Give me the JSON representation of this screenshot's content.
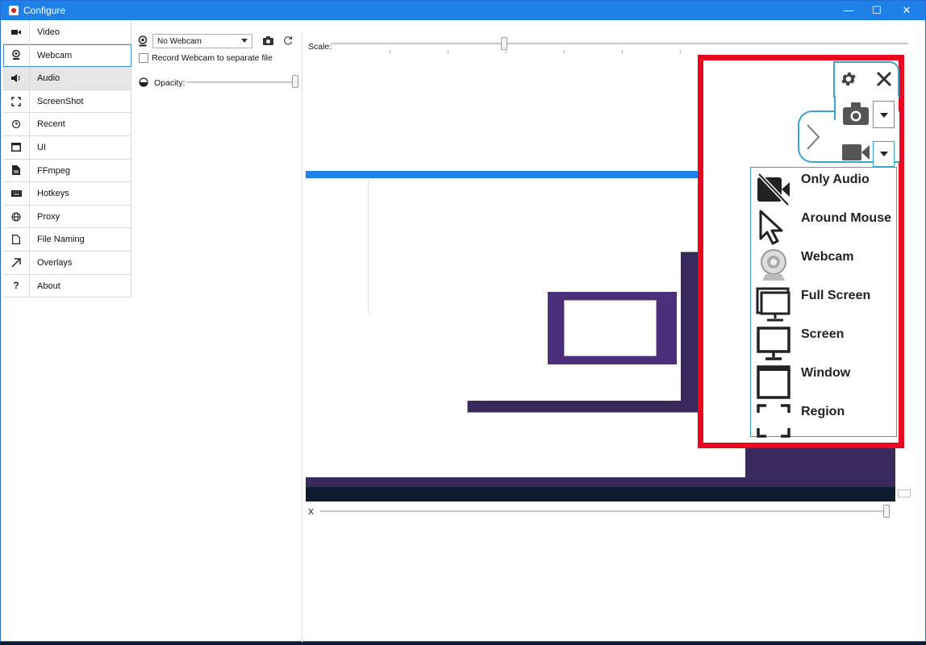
{
  "window": {
    "title": "Configure",
    "controls": [
      "—",
      "☐",
      "✕"
    ]
  },
  "sidebar": {
    "items": [
      {
        "label": "Video",
        "icon": "video-camera-icon"
      },
      {
        "label": "Webcam",
        "icon": "webcam-icon",
        "selected": true
      },
      {
        "label": "Audio",
        "icon": "speaker-icon",
        "hover": true
      },
      {
        "label": "ScreenShot",
        "icon": "screenshot-icon"
      },
      {
        "label": "Recent",
        "icon": "history-icon"
      },
      {
        "label": "UI",
        "icon": "window-icon"
      },
      {
        "label": "FFmpeg",
        "icon": "file-icon"
      },
      {
        "label": "Hotkeys",
        "icon": "keyboard-icon"
      },
      {
        "label": "Proxy",
        "icon": "globe-icon"
      },
      {
        "label": "File Naming",
        "icon": "document-icon"
      },
      {
        "label": "Overlays",
        "icon": "arrow-icon"
      },
      {
        "label": "About",
        "icon": "question-icon"
      }
    ]
  },
  "webcam": {
    "selected": "No Webcam",
    "record_separate_label": "Record Webcam to separate file",
    "opacity_label": "Opacity:"
  },
  "preview": {
    "scale_label": "Scale:",
    "x_label": "X"
  },
  "overlay_menu": {
    "items": [
      {
        "label": "Only Audio",
        "icon": "no-video-icon"
      },
      {
        "label": "Around Mouse",
        "icon": "cursor-icon"
      },
      {
        "label": "Webcam",
        "icon": "webcam-icon"
      },
      {
        "label": "Full Screen",
        "icon": "full-screen-icon"
      },
      {
        "label": "Screen",
        "icon": "monitor-icon"
      },
      {
        "label": "Window",
        "icon": "window-icon"
      },
      {
        "label": "Region",
        "icon": "region-icon"
      }
    ]
  },
  "colors": {
    "accent": "#1f80e8",
    "highlight": "#e8071e",
    "menu_border": "#3aa4c8"
  }
}
